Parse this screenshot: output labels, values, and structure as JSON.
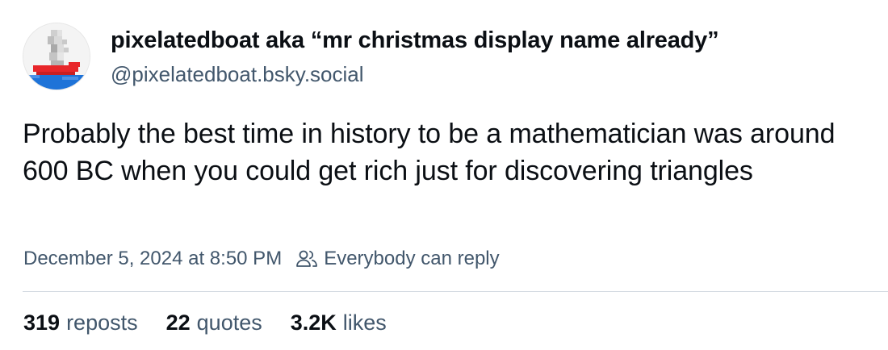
{
  "author": {
    "display_name": "pixelatedboat aka “mr christmas display name already”",
    "handle": "@pixelatedboat.bsky.social",
    "avatar_icon": "pixel-boat-avatar"
  },
  "post": {
    "text": "Probably the best time in history to be a mathematician was around 600 BC when you could get rich just for discovering triangles"
  },
  "meta": {
    "timestamp": "December 5, 2024 at 8:50 PM",
    "reply_icon": "people-icon",
    "reply_setting": "Everybody can reply"
  },
  "stats": {
    "reposts": {
      "count": "319",
      "label": "reposts"
    },
    "quotes": {
      "count": "22",
      "label": "quotes"
    },
    "likes": {
      "count": "3.2K",
      "label": "likes"
    }
  },
  "colors": {
    "text": "#0b0f14",
    "muted": "#42576c",
    "divider": "#d4dbe2",
    "boat_red": "#e8262a",
    "boat_blue": "#1e73d8"
  }
}
